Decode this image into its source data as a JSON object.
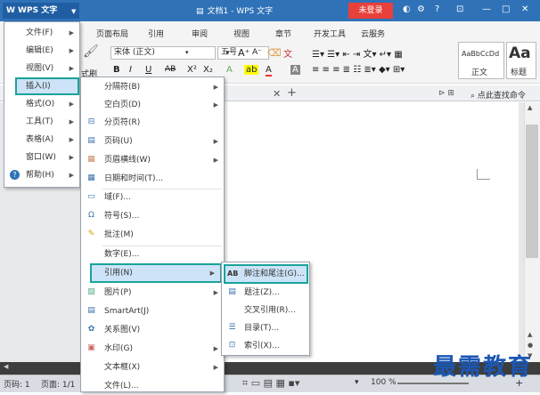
{
  "app": {
    "logo": "W WPS 文字",
    "doc_title": "文档1 - WPS 文字",
    "login": "未登录",
    "help": "?",
    "window_controls": [
      "—",
      "□",
      "✕"
    ]
  },
  "ribbon": {
    "tabs": [
      "页面布局",
      "引用",
      "审阅",
      "视图",
      "章节",
      "开发工具",
      "云服务"
    ],
    "font_name": "宋体 (正文)",
    "font_size": "五号",
    "format_painter": "式刷",
    "styles": [
      {
        "label": "正文",
        "preview": "AaBbCcDd"
      },
      {
        "label": "标题",
        "preview": "Aa"
      }
    ],
    "find": "点此查找命令"
  },
  "main_menu": {
    "items": [
      {
        "label": "文件(F)",
        "has_sub": true
      },
      {
        "label": "编辑(E)",
        "has_sub": true
      },
      {
        "label": "视图(V)",
        "has_sub": true
      },
      {
        "label": "插入(I)",
        "has_sub": true,
        "selected": true
      },
      {
        "label": "格式(O)",
        "has_sub": true
      },
      {
        "label": "工具(T)",
        "has_sub": true
      },
      {
        "label": "表格(A)",
        "has_sub": true
      },
      {
        "label": "窗口(W)",
        "has_sub": true
      },
      {
        "label": "帮助(H)",
        "has_sub": true
      }
    ]
  },
  "insert_menu": {
    "items": [
      {
        "label": "分隔符(B)",
        "has_sub": true
      },
      {
        "label": "空白页(D)",
        "has_sub": true
      },
      {
        "label": "分页符(R)",
        "icon": "page-break-icon"
      },
      {
        "label": "页码(U)",
        "has_sub": true,
        "icon": "page-number-icon"
      },
      {
        "label": "页眉横线(W)",
        "has_sub": true,
        "icon": "header-line-icon"
      },
      {
        "label": "日期和时间(T)...",
        "icon": "calendar-icon"
      },
      {
        "label": "域(F)...",
        "icon": "field-icon"
      },
      {
        "label": "符号(S)...",
        "icon": "symbol-icon"
      },
      {
        "label": "批注(M)",
        "icon": "comment-icon"
      },
      {
        "label": "数字(E)..."
      },
      {
        "label": "引用(N)",
        "has_sub": true,
        "selected": true
      },
      {
        "label": "图片(P)",
        "has_sub": true,
        "icon": "picture-icon"
      },
      {
        "label": "SmartArt(J)",
        "icon": "smartart-icon"
      },
      {
        "label": "关系图(V)",
        "icon": "relation-icon"
      },
      {
        "label": "水印(G)",
        "has_sub": true,
        "icon": "watermark-icon"
      },
      {
        "label": "文本框(X)",
        "has_sub": true
      },
      {
        "label": "文件(L)..."
      }
    ]
  },
  "reference_menu": {
    "items": [
      {
        "label": "脚注和尾注(G)...",
        "icon": "footnote-icon",
        "selected": true
      },
      {
        "label": "题注(Z)...",
        "icon": "caption-icon"
      },
      {
        "label": "交叉引用(R)..."
      },
      {
        "label": "目录(T)...",
        "icon": "toc-icon"
      },
      {
        "label": "索引(X)...",
        "icon": "index-icon"
      }
    ]
  },
  "status": {
    "page_num": "页码: 1",
    "pages": "页面: 1/1",
    "zoom": "100 %"
  },
  "watermark_text": "最需教育",
  "colors": {
    "title_bar": "#2f72b8",
    "login": "#e8403a",
    "highlight_border": "#1aa39a",
    "menu_selected": "#cde3f7"
  }
}
